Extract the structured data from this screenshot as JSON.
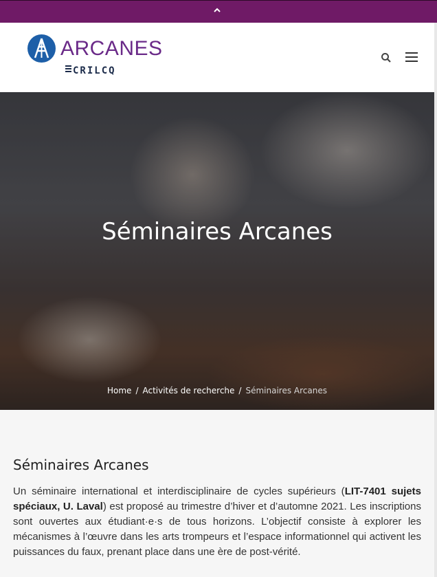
{
  "topbar": {
    "icon": "chevron-up-icon",
    "color": "#6f1a66"
  },
  "logo": {
    "name": "ARCANES",
    "sub": "CRILCQ"
  },
  "header": {
    "search_icon": "search-icon",
    "menu_icon": "hamburger-menu-icon"
  },
  "hero": {
    "title": "Séminaires Arcanes"
  },
  "breadcrumb": {
    "home": "Home",
    "section": "Activités de recherche",
    "current": "Séminaires Arcanes"
  },
  "content": {
    "heading": "Séminaires Arcanes",
    "para_part1": "Un séminaire international et interdisciplinaire de cycles supérieurs (",
    "para_bold": "LIT-7401 sujets spéciaux, U. Laval",
    "para_part2": ") est proposé au trimestre d’hiver et d’automne 2021. Les inscriptions sont ouvertes aux étudiant·e·s de tous horizons. L’objectif consiste à explorer les mécanismes à l’œuvre dans les arts trompeurs et l’espace informationnel qui activent les puissances du faux, prenant place dans une ère de post-vérité."
  }
}
